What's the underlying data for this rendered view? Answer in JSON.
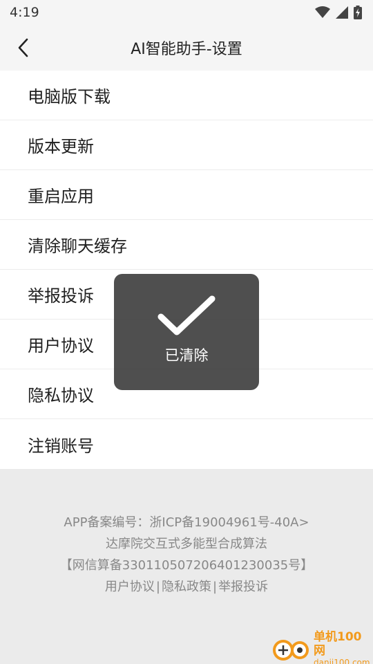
{
  "status_bar": {
    "time": "4:19",
    "icons": [
      "wifi-icon",
      "signal-icon",
      "battery-charging-icon"
    ]
  },
  "header": {
    "title": "AI智能助手-设置",
    "back_icon": "chevron-left-icon"
  },
  "menu": {
    "items": [
      {
        "label": "电脑版下载"
      },
      {
        "label": "版本更新"
      },
      {
        "label": "重启应用"
      },
      {
        "label": "清除聊天缓存"
      },
      {
        "label": "举报投诉"
      },
      {
        "label": "用户协议"
      },
      {
        "label": "隐私协议"
      },
      {
        "label": "注销账号"
      }
    ]
  },
  "footer": {
    "line1": "APP备案编号：浙ICP备19004961号-40A>",
    "line2": "达摩院交互式多能型合成算法",
    "line3": "【网信算备330110507206401230035号】",
    "links": [
      "用户协议",
      "隐私政策",
      "举报投诉"
    ],
    "separator": "|"
  },
  "toast": {
    "icon": "checkmark-icon",
    "text": "已清除"
  },
  "watermark": {
    "name": "单机100网",
    "url": "danji100.com"
  },
  "colors": {
    "background": "#ebebeb",
    "toast_bg": "#3c3c3c",
    "watermark": "#f29a1c"
  }
}
